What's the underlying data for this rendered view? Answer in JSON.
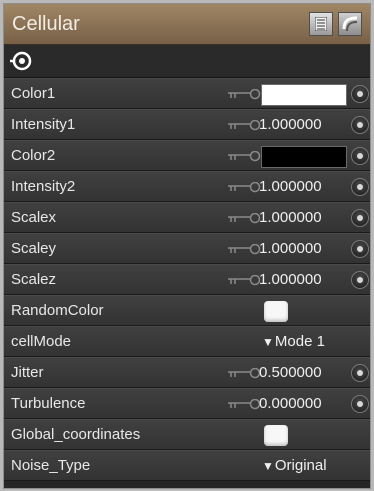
{
  "panel": {
    "title": "Cellular",
    "title_icons": [
      "list-icon",
      "layers-icon"
    ],
    "toolbar_icon": "target-icon"
  },
  "colors": {
    "title_bar": "#8f7656",
    "row_bg": "#3a3a3a",
    "text": "#e8e8e8",
    "color1_swatch": "#ffffff",
    "color2_swatch": "#000000"
  },
  "params": [
    {
      "label": "Color1",
      "type": "color",
      "color": "#ffffff"
    },
    {
      "label": "Intensity1",
      "type": "number",
      "value": "1.000000"
    },
    {
      "label": "Color2",
      "type": "color",
      "color": "#000000"
    },
    {
      "label": "Intensity2",
      "type": "number",
      "value": "1.000000"
    },
    {
      "label": "Scalex",
      "type": "number",
      "value": "1.000000"
    },
    {
      "label": "Scaley",
      "type": "number",
      "value": "1.000000"
    },
    {
      "label": "Scalez",
      "type": "number",
      "value": "1.000000"
    },
    {
      "label": "RandomColor",
      "type": "checkbox"
    },
    {
      "label": "cellMode",
      "type": "select",
      "value": "Mode 1"
    },
    {
      "label": "Jitter",
      "type": "number",
      "value": "0.500000"
    },
    {
      "label": "Turbulence",
      "type": "number",
      "value": "0.000000"
    },
    {
      "label": "Global_coordinates",
      "type": "checkbox"
    },
    {
      "label": "Noise_Type",
      "type": "select",
      "value": "Original"
    }
  ]
}
